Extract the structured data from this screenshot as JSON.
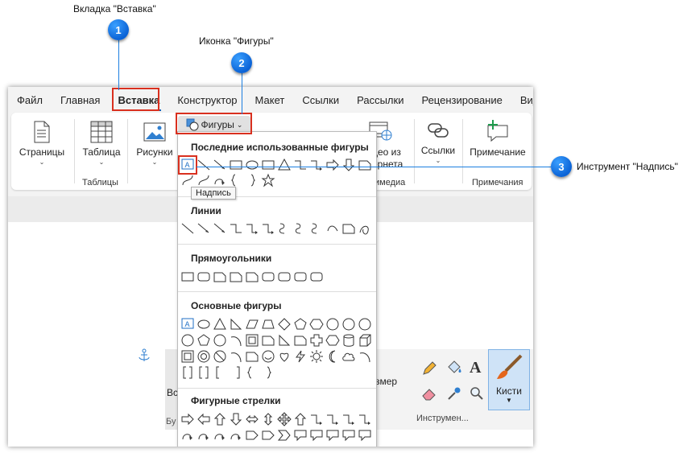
{
  "callouts": [
    {
      "num": "1",
      "label": "Вкладка \"Вставка\""
    },
    {
      "num": "2",
      "label": "Иконка \"Фигуры\""
    },
    {
      "num": "3",
      "label": "Инструмент \"Надпись\""
    }
  ],
  "menubar": [
    "Файл",
    "Главная",
    "Вставка",
    "Конструктор",
    "Макет",
    "Ссылки",
    "Рассылки",
    "Рецензирование",
    "Вид"
  ],
  "ribbon": {
    "pages_label": "Страницы",
    "table_label": "Таблица",
    "tables_group": "Таблицы",
    "pictures_label": "Рисунки",
    "shapes_label": "Фигуры",
    "video_label": "Видео из Интернета",
    "video_short": "део из",
    "video_short2": "ернета",
    "media_group": "тимедиа",
    "links_label": "Ссылки",
    "comment_label": "Примечание",
    "comments_group": "Примечания"
  },
  "dropdown": {
    "recent": "Последние использованные фигуры",
    "lines": "Линии",
    "rects": "Прямоугольники",
    "basic": "Основные фигуры",
    "arrows": "Фигурные стрелки",
    "tooltip": "Надпись"
  },
  "paint": {
    "size_label": "змер",
    "tools_label": "Инструмен...",
    "brushes_label": "Кисти",
    "left_cut1": "Вс",
    "left_cut2": "Бу"
  }
}
